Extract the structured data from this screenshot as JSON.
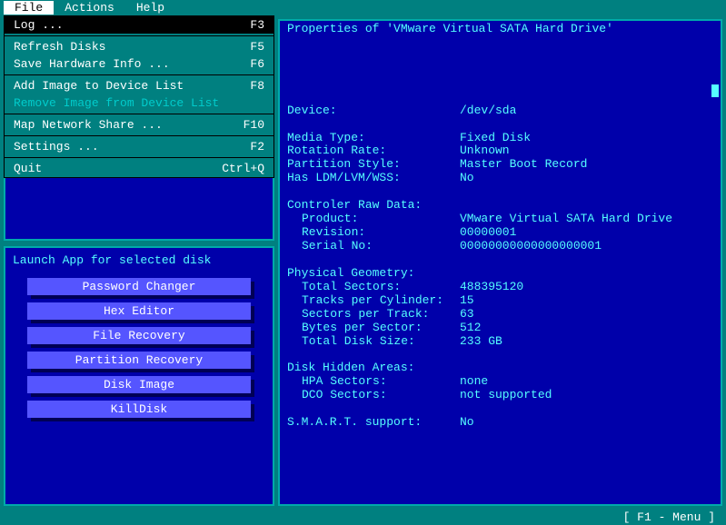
{
  "menubar": {
    "file": "File",
    "actions": "Actions",
    "help": "Help"
  },
  "file_menu": {
    "log": {
      "label": "Log ...",
      "key": "F3"
    },
    "refresh": {
      "label": "Refresh Disks",
      "key": "F5"
    },
    "savehw": {
      "label": "Save Hardware Info ...",
      "key": "F6"
    },
    "addimg": {
      "label": "Add Image to Device List",
      "key": "F8"
    },
    "rmimg": {
      "label": "Remove Image from Device List",
      "key": ""
    },
    "mapnet": {
      "label": "Map Network Share ...",
      "key": "F10"
    },
    "settings": {
      "label": "Settings ...",
      "key": "F2"
    },
    "quit": {
      "label": "Quit",
      "key": "Ctrl+Q"
    }
  },
  "launch": {
    "title": "Launch App for selected disk",
    "buttons": {
      "pw": "Password Changer",
      "hex": "Hex Editor",
      "fr": "File Recovery",
      "pr": "Partition Recovery",
      "di": "Disk Image",
      "kd": "KillDisk"
    }
  },
  "props": {
    "title": "Properties of 'VMware Virtual SATA Hard Drive'",
    "device_l": "Device:",
    "device_v": "/dev/sda",
    "spacer": " ",
    "media_l": "Media Type:",
    "media_v": "Fixed Disk",
    "rot_l": "Rotation Rate:",
    "rot_v": "Unknown",
    "pstyle_l": "Partition Style:",
    "pstyle_v": "Master Boot Record",
    "ldm_l": "Has LDM/LVM/WSS:",
    "ldm_v": "No",
    "ctrl_h": "Controler Raw Data:",
    "prod_l": "Product:",
    "prod_v": "VMware Virtual SATA Hard Drive",
    "rev_l": "Revision:",
    "rev_v": "00000001",
    "ser_l": "Serial No:",
    "ser_v": "00000000000000000001",
    "pg_h": "Physical Geometry:",
    "ts_l": "Total Sectors:",
    "ts_v": "488395120",
    "tpc_l": "Tracks per Cylinder:",
    "tpc_v": "15",
    "spt_l": "Sectors per Track:",
    "spt_v": "63",
    "bps_l": "Bytes per Sector:",
    "bps_v": "512",
    "tds_l": "Total Disk Size:",
    "tds_v": "233 GB",
    "dha_h": "Disk Hidden Areas:",
    "hpa_l": "HPA Sectors:",
    "hpa_v": "none",
    "dco_l": "DCO Sectors:",
    "dco_v": "not supported",
    "smart_l": "S.M.A.R.T. support:",
    "smart_v": "No"
  },
  "status": {
    "hint": "[ F1 - Menu ]"
  }
}
